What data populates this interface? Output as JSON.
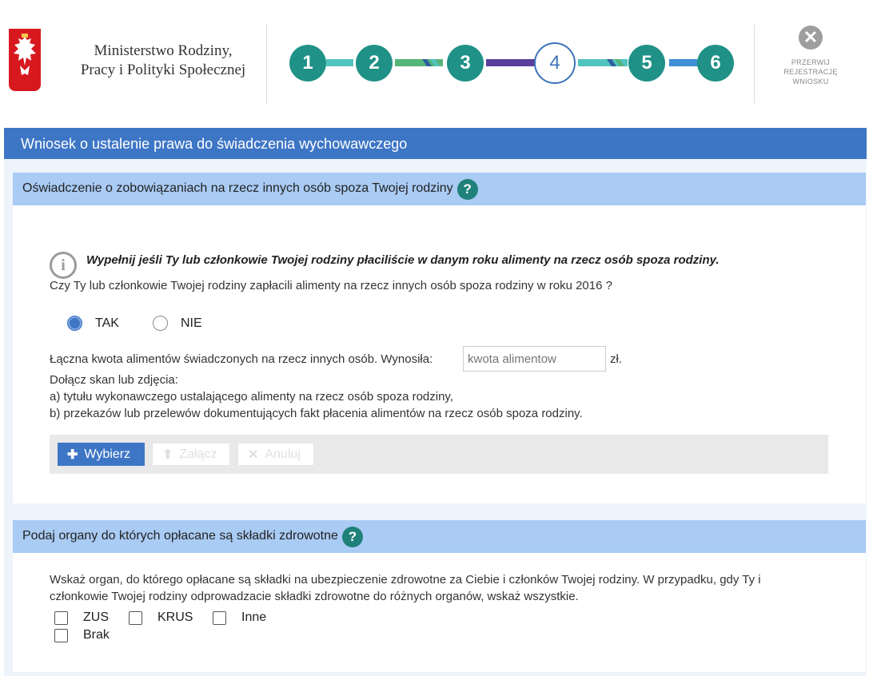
{
  "header": {
    "ministry_line1": "Ministerstwo Rodziny,",
    "ministry_line2": "Pracy i Polityki Społecznej",
    "steps": [
      "1",
      "2",
      "3",
      "4",
      "5",
      "6"
    ],
    "active_step": "4",
    "cancel_line1": "PRZERWIJ",
    "cancel_line2": "REJESTRACJĘ",
    "cancel_line3": "WNIOSKU",
    "cancel_icon": "close-icon"
  },
  "colors": {
    "title_bar": "#3e76c6",
    "section_header": "#a9cbf4",
    "step_done": "#1f9186",
    "step_active": "#3c73b9"
  },
  "form_title": "Wniosek o ustalenie prawa do świadczenia wychowawczego",
  "section1": {
    "title": "Oświadczenie o zobowiązaniach na rzecz innych osób spoza Twojej rodziny",
    "help_icon": "?",
    "info_icon": "i",
    "info_text": "Wypełnij jeśli Ty lub członkowie Twojej rodziny płaciliście w danym roku alimenty na rzecz osób spoza rodziny.",
    "question": "Czy Ty lub członkowie Twojej rodziny zapłacili alimenty na rzecz innych osób spoza rodziny w roku 2016 ?",
    "option_yes": "TAK",
    "option_no": "NIE",
    "selected": "TAK",
    "amount_label": "Łączna kwota alimentów świadczonych na rzecz innych osób. Wynosiła:",
    "amount_placeholder": "kwota alimentow",
    "amount_value": "",
    "amount_unit": "zł.",
    "attach_line1": "Dołącz skan lub zdjęcia:",
    "attach_line2": "a) tytułu wykonawczego ustalającego alimenty na rzecz osób spoza rodziny,",
    "attach_line3": "b) przekazów lub przelewów dokumentujących fakt płacenia alimentów na rzecz osób spoza rodziny.",
    "btn_choose": "Wybierz",
    "btn_attach": "Załącz",
    "btn_cancel": "Anuluj"
  },
  "section2": {
    "title": "Podaj organy do których opłacane są składki zdrowotne",
    "help_icon": "?",
    "desc_line1": "Wskaż organ, do którego opłacane są składki na ubezpieczenie zdrowotne za Ciebie i członków Twojej rodziny. W przypadku, gdy Ty i",
    "desc_line2": "członkowie Twojej rodziny odprowadzacie składki zdrowotne do różnych organów, wskaż wszystkie.",
    "options": [
      "ZUS",
      "KRUS",
      "Inne",
      "Brak"
    ]
  }
}
